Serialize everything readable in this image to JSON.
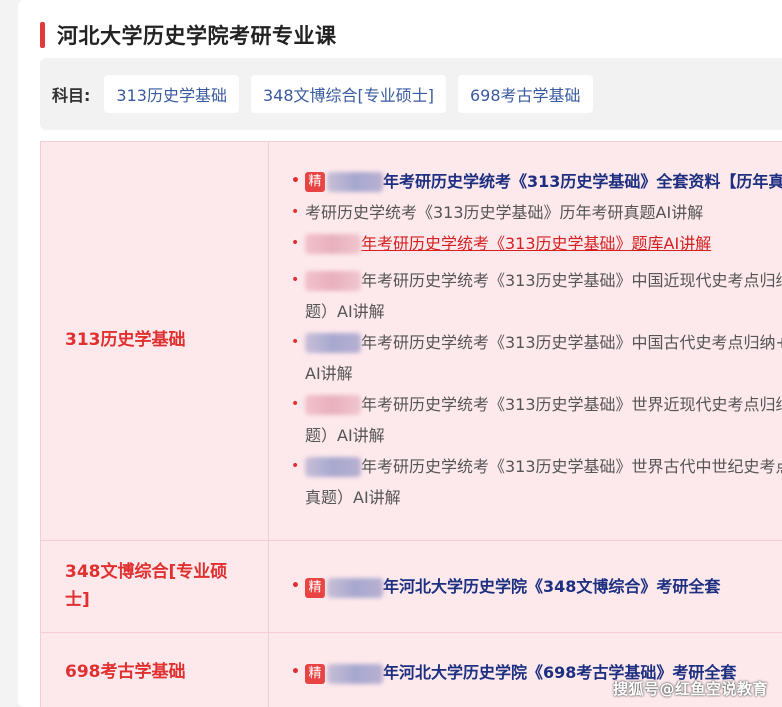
{
  "page": {
    "title": "河北大学历史学院考研专业课",
    "accent_color": "#e03a3a"
  },
  "subjects": {
    "label": "科目:",
    "chips": [
      "313历史学基础",
      "348文博综合[专业硕士]",
      "698考古学基础"
    ]
  },
  "rows": [
    {
      "subject": "313历史学基础",
      "items": [
        {
          "badge": "精",
          "text": "年考研历史学统考《313历史学基础》全套资料【历年真"
        },
        {
          "text": "考研历史学统考《313历史学基础》历年考研真题AI讲解"
        },
        {
          "text": "年考研历史学统考《313历史学基础》题库AI讲解"
        },
        {
          "text": "年考研历史学统考《313历史学基础》中国近现代史考点归纳",
          "cont": "题）AI讲解"
        },
        {
          "text": "年考研历史学统考《313历史学基础》中国古代史考点归纳+",
          "cont": "AI讲解"
        },
        {
          "text": "年考研历史学统考《313历史学基础》世界近现代史考点归纳",
          "cont": "题）AI讲解"
        },
        {
          "text": "年考研历史学统考《313历史学基础》世界古代中世纪史考点",
          "cont": "真题）AI讲解"
        }
      ]
    },
    {
      "subject": "348文博综合[专业硕士]",
      "items": [
        {
          "badge": "精",
          "text": "年河北大学历史学院《348文博综合》考研全套"
        }
      ]
    },
    {
      "subject": "698考古学基础",
      "items": [
        {
          "badge": "精",
          "text": "年河北大学历史学院《698考古学基础》考研全套"
        }
      ]
    }
  ],
  "watermark": "搜狐号@红鱼空说教育"
}
